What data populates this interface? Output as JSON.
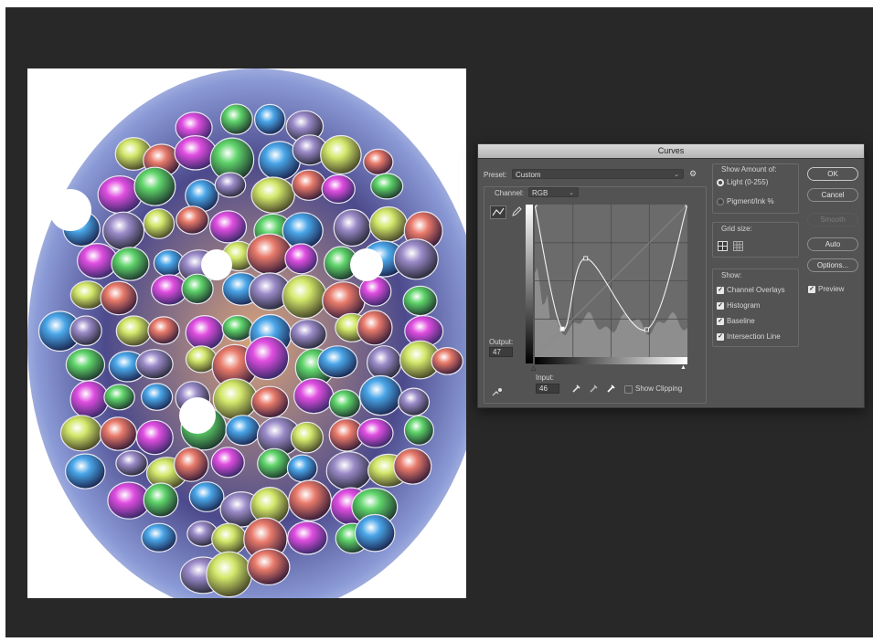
{
  "dialog": {
    "title": "Curves",
    "preset_label": "Preset:",
    "preset_value": "Custom",
    "channel_label": "Channel:",
    "channel_value": "RGB",
    "output_label": "Output:",
    "output_value": "47",
    "input_label": "Input:",
    "input_value": "46",
    "show_clipping_label": "Show Clipping",
    "show_clipping_checked": false,
    "show_amount": {
      "title": "Show Amount of:",
      "options": [
        {
          "label": "Light  (0-255)",
          "selected": true
        },
        {
          "label": "Pigment/Ink %",
          "selected": false
        }
      ]
    },
    "grid_size": {
      "title": "Grid size:",
      "icons": [
        "grid-coarse-icon",
        "grid-fine-icon"
      ]
    },
    "show": {
      "title": "Show:",
      "items": [
        {
          "label": "Channel Overlays",
          "checked": true
        },
        {
          "label": "Histogram",
          "checked": true
        },
        {
          "label": "Baseline",
          "checked": true
        },
        {
          "label": "Intersection Line",
          "checked": true
        }
      ]
    },
    "buttons": {
      "ok": "OK",
      "cancel": "Cancel",
      "smooth": "Smooth",
      "auto": "Auto",
      "options": "Options..."
    },
    "preview_label": "Preview",
    "preview_checked": true,
    "curve_points": [
      {
        "input": 0,
        "output": 255
      },
      {
        "input": 46,
        "output": 47
      },
      {
        "input": 85,
        "output": 165
      },
      {
        "input": 187,
        "output": 46
      },
      {
        "input": 255,
        "output": 255
      }
    ]
  },
  "canvas": {
    "description_icon": "image-canvas"
  }
}
